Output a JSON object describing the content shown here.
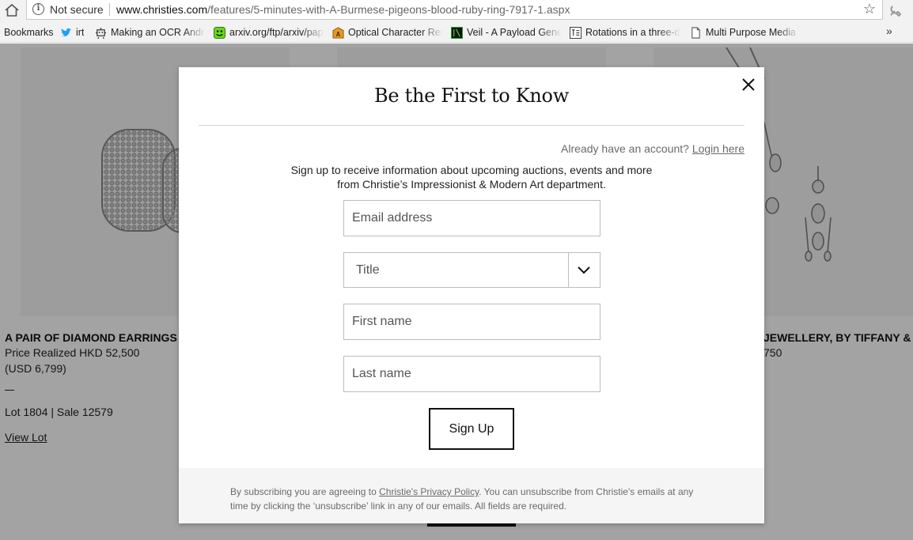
{
  "browser": {
    "security_label": "Not secure",
    "url_host": "www.christies.com",
    "url_path": "/features/5-minutes-with-A-Burmese-pigeons-blood-ruby-ring-7917-1.aspx",
    "bookmarks": [
      {
        "label": "Bookmarks",
        "icon": "none"
      },
      {
        "label": "irt",
        "icon": "twitter-bird-icon"
      },
      {
        "label": "Making an OCR Andr",
        "icon": "robot-icon"
      },
      {
        "label": "arxiv.org/ftp/arxiv/pap",
        "icon": "smiley-icon"
      },
      {
        "label": "Optical Character Rec",
        "icon": "ocr-icon"
      },
      {
        "label": "Veil - A Payload Gene",
        "icon": "terminal-icon"
      },
      {
        "label": "Rotations in a three-d",
        "icon": "math-icon"
      },
      {
        "label": "Multi Purpose Media",
        "icon": "page-icon"
      }
    ],
    "more_label": "»"
  },
  "page": {
    "left_lot": {
      "title": "A PAIR OF DIAMOND EARRINGS",
      "price": "Price Realized HKD 52,500",
      "usd": "(USD 6,799)",
      "lot_sale": "Lot 1804 | Sale 12579",
      "view_lot": "View Lot"
    },
    "right_lot": {
      "title_fragment": "JEWELLERY, BY TIFFANY &",
      "price_fragment": "750"
    }
  },
  "modal": {
    "title": "Be the First to Know",
    "account_question": "Already have an account?",
    "login_link": "Login here",
    "description": "Sign up to receive information about upcoming auctions, events and more from Christie’s Impressionist & Modern Art department.",
    "email_placeholder": "Email address",
    "title_select": "Title",
    "first_name_placeholder": "First name",
    "last_name_placeholder": "Last name",
    "signup_label": "Sign Up",
    "footer_before": "By subscribing you are agreeing to ",
    "privacy_link": "Christie's Privacy Policy",
    "footer_after": ". You can unsubscribe from Christie's emails at any time by clicking the ‘unsubscribe’ link in any of our emails. All fields are required."
  },
  "colors": {
    "overlay": "#5c5c5c",
    "muted_text": "#6a6a6a",
    "footer_bg": "#f5f5f5",
    "twitter": "#1da1f2"
  }
}
